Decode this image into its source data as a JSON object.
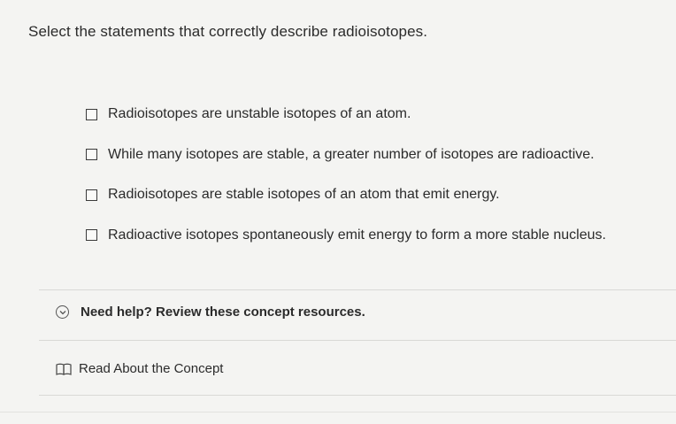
{
  "question": "Select the statements that correctly describe radioisotopes.",
  "options": [
    {
      "label": "Radioisotopes are unstable isotopes of an atom.",
      "checked": false
    },
    {
      "label": "While many isotopes are stable, a greater number of isotopes are radioactive.",
      "checked": false
    },
    {
      "label": "Radioisotopes are stable isotopes of an atom that emit energy.",
      "checked": false
    },
    {
      "label": "Radioactive isotopes spontaneously emit energy to form a more stable nucleus.",
      "checked": false
    }
  ],
  "help": {
    "label": "Need help? Review these concept resources.",
    "icon": "chevron-down-circle-icon"
  },
  "resource": {
    "label": "Read About the Concept",
    "icon": "book-icon"
  }
}
